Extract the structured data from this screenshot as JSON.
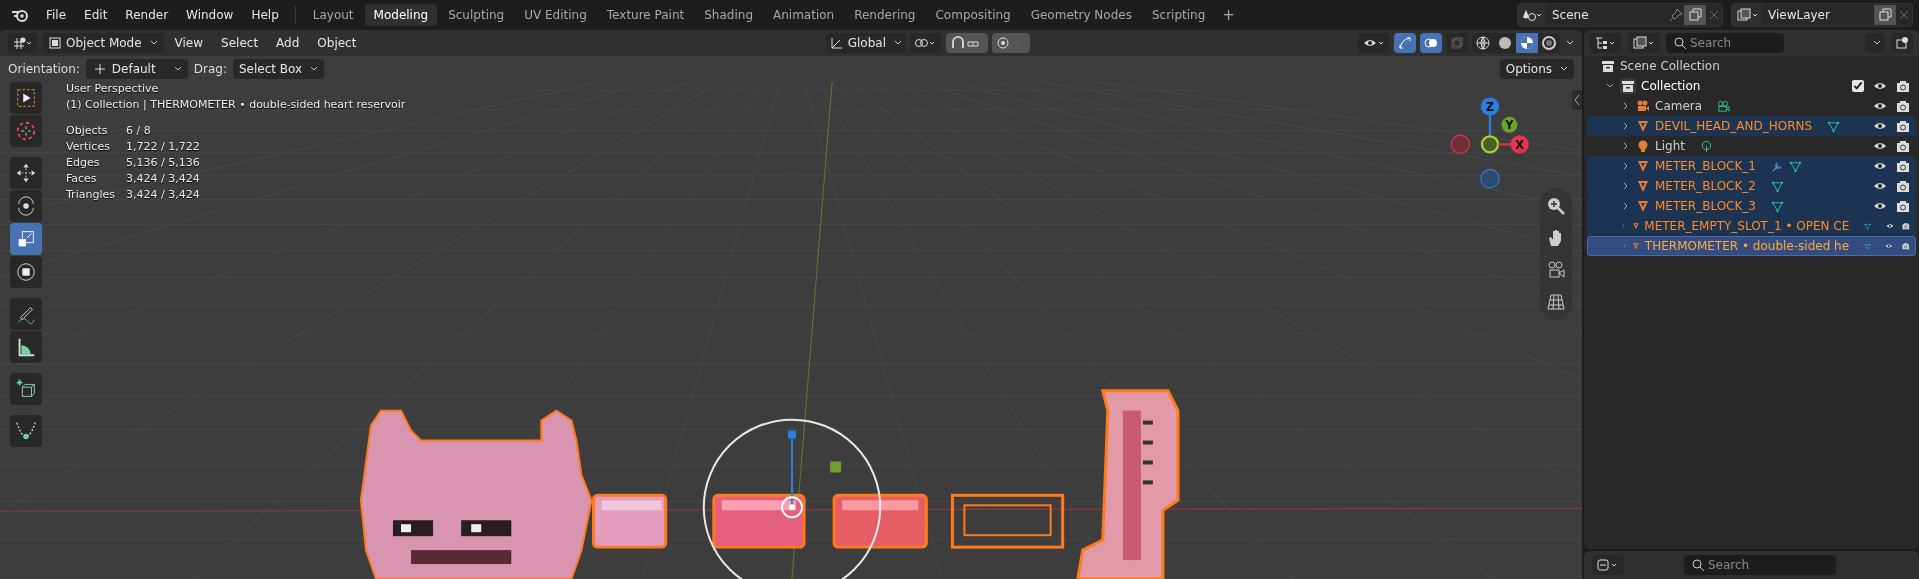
{
  "menu": [
    "File",
    "Edit",
    "Render",
    "Window",
    "Help"
  ],
  "workspaces": [
    {
      "label": "Layout",
      "selected": false
    },
    {
      "label": "Modeling",
      "selected": true
    },
    {
      "label": "Sculpting",
      "selected": false
    },
    {
      "label": "UV Editing",
      "selected": false
    },
    {
      "label": "Texture Paint",
      "selected": false
    },
    {
      "label": "Shading",
      "selected": false
    },
    {
      "label": "Animation",
      "selected": false
    },
    {
      "label": "Rendering",
      "selected": false
    },
    {
      "label": "Compositing",
      "selected": false
    },
    {
      "label": "Geometry Nodes",
      "selected": false
    },
    {
      "label": "Scripting",
      "selected": false
    }
  ],
  "add_tab": "+",
  "scene": "Scene",
  "view_layer": "ViewLayer",
  "viewport_header": {
    "mode": "Object Mode",
    "menus": [
      "View",
      "Select",
      "Add",
      "Object"
    ],
    "transform": "Global"
  },
  "tool_settings": {
    "orientation_label": "Orientation:",
    "orientation": "Default",
    "drag_label": "Drag:",
    "drag": "Select Box",
    "options": "Options"
  },
  "overlay": {
    "view": "User Perspective",
    "context": "(1) Collection | THERMOMETER • double-sided heart reservoir",
    "stats": [
      {
        "label": "Objects",
        "value": "6 / 8"
      },
      {
        "label": "Vertices",
        "value": "1,722 / 1,722"
      },
      {
        "label": "Edges",
        "value": "5,136 / 5,136"
      },
      {
        "label": "Faces",
        "value": "3,424 / 3,424"
      },
      {
        "label": "Triangles",
        "value": "3,424 / 3,424"
      }
    ]
  },
  "tools": [
    {
      "kind": "select",
      "selected": false
    },
    {
      "kind": "cursor",
      "selected": false
    },
    {
      "kind": "move",
      "selected": false
    },
    {
      "kind": "rotate",
      "selected": false
    },
    {
      "kind": "scale",
      "selected": true
    },
    {
      "kind": "transform",
      "selected": false
    },
    {
      "kind": "annotate",
      "selected": false
    },
    {
      "kind": "measure",
      "selected": false
    },
    {
      "kind": "add-cube",
      "selected": false
    },
    {
      "kind": "curve",
      "selected": false
    }
  ],
  "axes": [
    {
      "kind": "z",
      "label": "Z"
    },
    {
      "kind": "y",
      "label": "Y"
    },
    {
      "kind": "x",
      "label": "X"
    }
  ],
  "outliner": {
    "search_placeholder": "Search",
    "root": "Scene Collection",
    "collection": {
      "name": "Collection",
      "checked": true,
      "children": [
        {
          "name": "Camera",
          "kind": "camera",
          "selected": false,
          "active": false,
          "modifier": false
        },
        {
          "name": "DEVIL_HEAD_AND_HORNS",
          "kind": "mesh",
          "selected": true,
          "active": false,
          "modifier": false
        },
        {
          "name": "Light",
          "kind": "light",
          "selected": false,
          "active": false,
          "modifier": false
        },
        {
          "name": "METER_BLOCK_1",
          "kind": "mesh",
          "selected": true,
          "active": false,
          "modifier": true
        },
        {
          "name": "METER_BLOCK_2",
          "kind": "mesh",
          "selected": true,
          "active": false,
          "modifier": false
        },
        {
          "name": "METER_BLOCK_3",
          "kind": "mesh",
          "selected": true,
          "active": false,
          "modifier": false
        },
        {
          "name": "METER_EMPTY_SLOT_1 • OPEN CE",
          "kind": "mesh",
          "selected": true,
          "active": false,
          "modifier": false
        },
        {
          "name": "THERMOMETER • double-sided he",
          "kind": "mesh",
          "selected": true,
          "active": true,
          "modifier": false
        }
      ]
    }
  },
  "properties": {
    "search_placeholder": "Search"
  }
}
